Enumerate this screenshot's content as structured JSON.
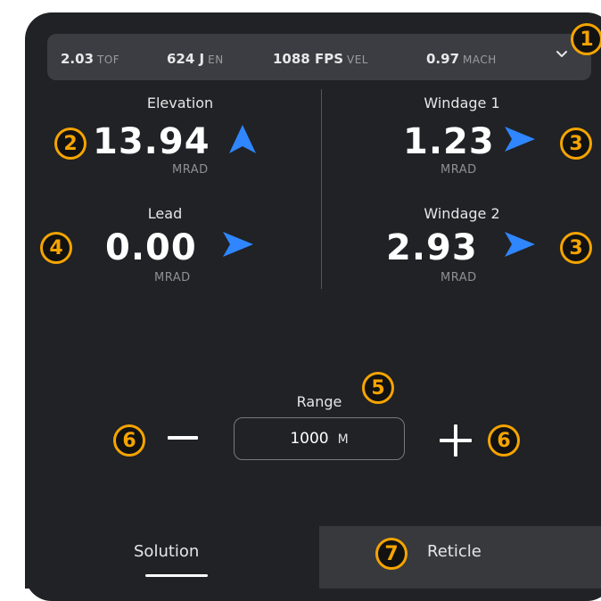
{
  "info_bar": {
    "items": [
      {
        "value": "2.03",
        "unit": "TOF"
      },
      {
        "value": "624 J",
        "unit": "EN"
      },
      {
        "value": "1088 FPS",
        "unit": "VEL"
      },
      {
        "value": "0.97",
        "unit": "MACH"
      }
    ]
  },
  "elevation": {
    "label": "Elevation",
    "value": "13.94",
    "unit": "MRAD"
  },
  "windage1": {
    "label": "Windage 1",
    "value": "1.23",
    "unit": "MRAD"
  },
  "lead": {
    "label": "Lead",
    "value": "0.00",
    "unit": "MRAD"
  },
  "windage2": {
    "label": "Windage 2",
    "value": "2.93",
    "unit": "MRAD"
  },
  "range": {
    "label": "Range",
    "value": "1000",
    "unit": "M"
  },
  "tabs": [
    {
      "label": "Solution",
      "active": true
    },
    {
      "label": "Reticle",
      "active": false
    }
  ],
  "callouts": [
    "1",
    "2",
    "3",
    "3",
    "4",
    "5",
    "6",
    "6",
    "7"
  ],
  "colors": {
    "accent_arrow": "#2f86ff",
    "callout": "#f5a400",
    "background": "#202225"
  }
}
